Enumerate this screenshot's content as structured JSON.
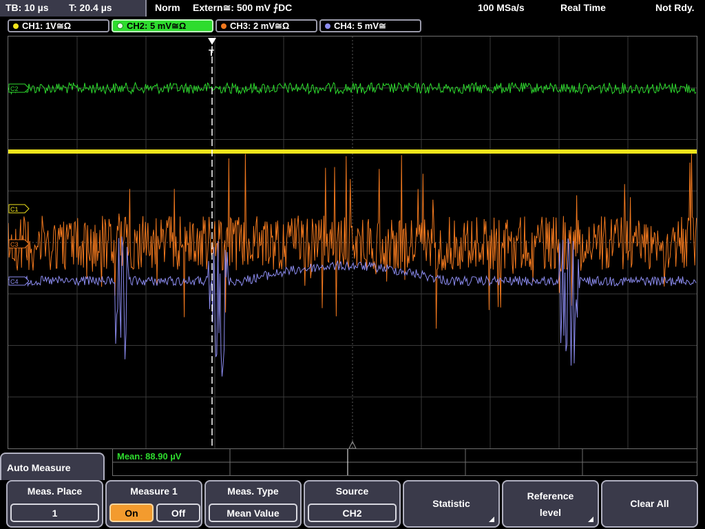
{
  "status": {
    "timebase": "TB: 10 µs",
    "trigger_time": "T: 20.4 µs",
    "trigger_mode": "Norm",
    "trigger_source": "Extern≅: 500 mV ⨍DC",
    "sample_rate": "100 MSa/s",
    "acq_mode": "Real Time",
    "state": "Not Rdy."
  },
  "channels": [
    {
      "label": "CH1: 1V≅Ω",
      "color": "#f2e51c"
    },
    {
      "label": "CH2: 5 mV≅Ω",
      "color": "#2edc2e"
    },
    {
      "label": "CH3: 2 mV≅Ω",
      "color": "#f0781e"
    },
    {
      "label": "CH4: 5 mV≅",
      "color": "#8c8cf0"
    }
  ],
  "markers": {
    "ch1": "C1",
    "ch2": "C2",
    "ch3": "C3",
    "ch4": "C4",
    "trigger": "T"
  },
  "measurement": {
    "readout": "Mean: 88.90 µV"
  },
  "menu": {
    "title": "Auto Measure",
    "keys": {
      "meas_place": {
        "label": "Meas. Place",
        "value": "1"
      },
      "measure": {
        "label": "Measure 1",
        "on": "On",
        "off": "Off"
      },
      "meas_type": {
        "label": "Meas. Type",
        "value": "Mean Value"
      },
      "source": {
        "label": "Source",
        "value": "CH2"
      },
      "statistic": {
        "label": "Statistic"
      },
      "reference_level": {
        "label1": "Reference",
        "label2": "level"
      },
      "clear_all": {
        "label": "Clear All"
      }
    }
  }
}
